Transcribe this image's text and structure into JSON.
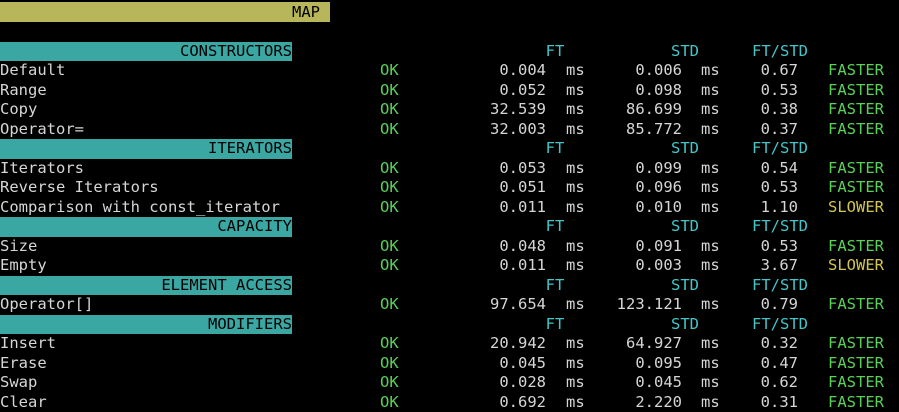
{
  "title": "MAP",
  "columns": {
    "ft": "FT",
    "std": "STD",
    "ratio": "FT/STD"
  },
  "units": "ms",
  "sections": [
    {
      "name": "CONSTRUCTORS",
      "rows": [
        {
          "label": "Default",
          "status": "OK",
          "ft": "0.004",
          "std": "0.006",
          "ratio": "0.67",
          "verdict": "FASTER"
        },
        {
          "label": "Range",
          "status": "OK",
          "ft": "0.052",
          "std": "0.098",
          "ratio": "0.53",
          "verdict": "FASTER"
        },
        {
          "label": "Copy",
          "status": "OK",
          "ft": "32.539",
          "std": "86.699",
          "ratio": "0.38",
          "verdict": "FASTER"
        },
        {
          "label": "Operator=",
          "status": "OK",
          "ft": "32.003",
          "std": "85.772",
          "ratio": "0.37",
          "verdict": "FASTER"
        }
      ]
    },
    {
      "name": "ITERATORS",
      "rows": [
        {
          "label": "Iterators",
          "status": "OK",
          "ft": "0.053",
          "std": "0.099",
          "ratio": "0.54",
          "verdict": "FASTER"
        },
        {
          "label": "Reverse Iterators",
          "status": "OK",
          "ft": "0.051",
          "std": "0.096",
          "ratio": "0.53",
          "verdict": "FASTER"
        },
        {
          "label": "Comparison with const_iterator",
          "status": "OK",
          "ft": "0.011",
          "std": "0.010",
          "ratio": "1.10",
          "verdict": "SLOWER"
        }
      ]
    },
    {
      "name": "CAPACITY",
      "rows": [
        {
          "label": "Size",
          "status": "OK",
          "ft": "0.048",
          "std": "0.091",
          "ratio": "0.53",
          "verdict": "FASTER"
        },
        {
          "label": "Empty",
          "status": "OK",
          "ft": "0.011",
          "std": "0.003",
          "ratio": "3.67",
          "verdict": "SLOWER"
        }
      ]
    },
    {
      "name": "ELEMENT ACCESS",
      "rows": [
        {
          "label": "Operator[]",
          "status": "OK",
          "ft": "97.654",
          "std": "123.121",
          "ratio": "0.79",
          "verdict": "FASTER"
        }
      ]
    },
    {
      "name": "MODIFIERS",
      "rows": [
        {
          "label": "Insert",
          "status": "OK",
          "ft": "20.942",
          "std": "64.927",
          "ratio": "0.32",
          "verdict": "FASTER"
        },
        {
          "label": "Erase",
          "status": "OK",
          "ft": "0.045",
          "std": "0.095",
          "ratio": "0.47",
          "verdict": "FASTER"
        },
        {
          "label": "Swap",
          "status": "OK",
          "ft": "0.028",
          "std": "0.045",
          "ratio": "0.62",
          "verdict": "FASTER"
        },
        {
          "label": "Clear",
          "status": "OK",
          "ft": "0.692",
          "std": "2.220",
          "ratio": "0.31",
          "verdict": "FASTER"
        }
      ]
    }
  ]
}
